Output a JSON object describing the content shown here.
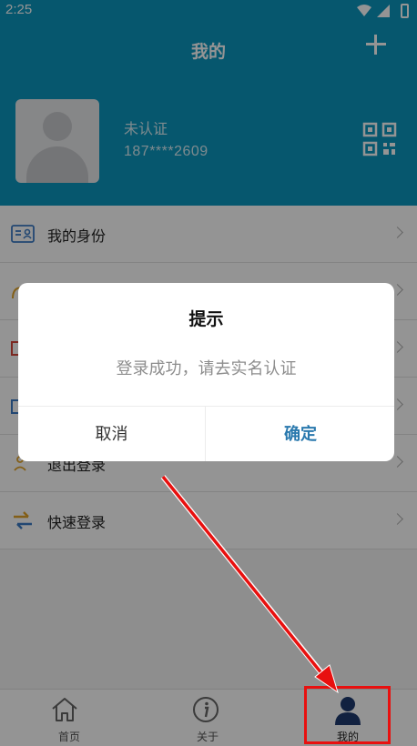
{
  "statusbar": {
    "time": "2:25"
  },
  "header": {
    "title": "我的"
  },
  "profile": {
    "cert_status": "未认证",
    "phone": "187****2609"
  },
  "menu": [
    {
      "label": "我的身份"
    },
    {
      "label": ""
    },
    {
      "label": ""
    },
    {
      "label": ""
    },
    {
      "label": "退出登录"
    },
    {
      "label": "快速登录"
    }
  ],
  "dialog": {
    "title": "提示",
    "message": "登录成功，请去实名认证",
    "cancel_label": "取消",
    "ok_label": "确定"
  },
  "bottom_nav": [
    {
      "label": "首页",
      "icon": "home-icon"
    },
    {
      "label": "关于",
      "icon": "info-icon"
    },
    {
      "label": "我的",
      "icon": "person-icon"
    }
  ],
  "colors": {
    "header_bg": "#0b96be",
    "accent": "#2a79ae",
    "annotation_red": "#e8100f"
  }
}
